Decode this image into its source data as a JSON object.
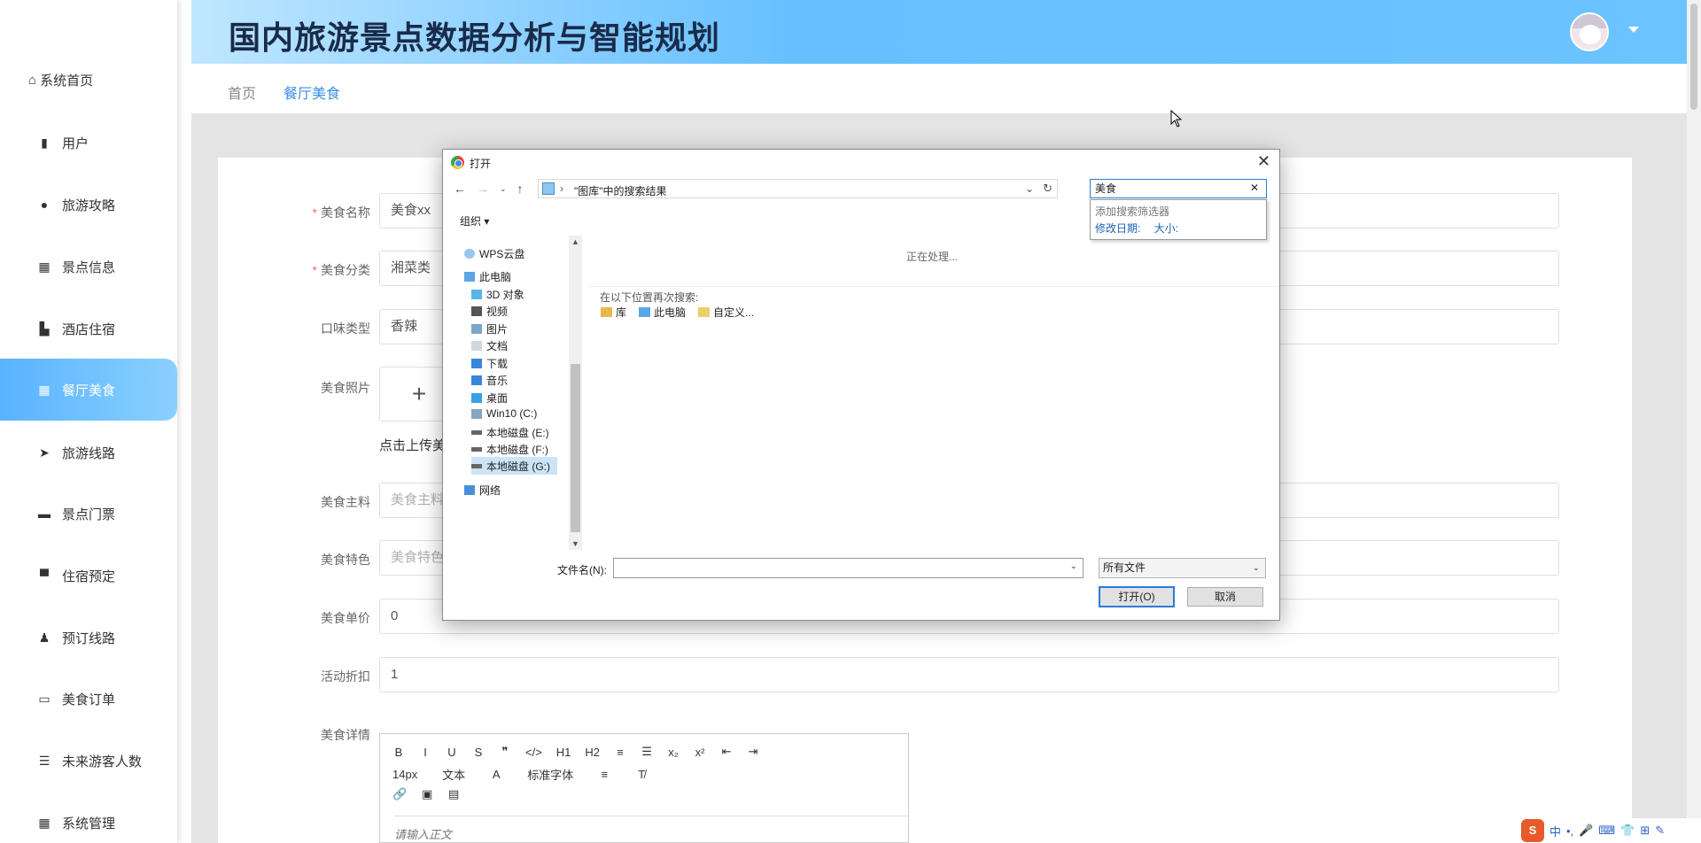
{
  "sidebar": {
    "home": "系统首页",
    "items": [
      {
        "label": "用户",
        "icon": "bar-chart-icon"
      },
      {
        "label": "旅游攻略",
        "icon": "user-icon"
      },
      {
        "label": "景点信息",
        "icon": "grid-icon"
      },
      {
        "label": "酒店住宿",
        "icon": "building-icon"
      },
      {
        "label": "餐厅美食",
        "icon": "grid-icon",
        "active": true
      },
      {
        "label": "旅游线路",
        "icon": "send-icon"
      },
      {
        "label": "景点门票",
        "icon": "ticket-icon"
      },
      {
        "label": "住宿预定",
        "icon": "bed-icon"
      },
      {
        "label": "预订线路",
        "icon": "person-icon"
      },
      {
        "label": "美食订单",
        "icon": "monitor-icon"
      },
      {
        "label": "未来游客人数",
        "icon": "list-icon"
      },
      {
        "label": "系统管理",
        "icon": "grid-icon"
      }
    ]
  },
  "header": {
    "title": "国内旅游景点数据分析与智能规划"
  },
  "breadcrumb": [
    "首页",
    "餐厅美食"
  ],
  "form": {
    "name_label": "美食名称",
    "name_value": "美食xx",
    "category_label": "美食分类",
    "category_value": "湘菜类",
    "taste_label": "口味类型",
    "taste_value": "香辣",
    "photo_label": "美食照片",
    "upload_plus": "+",
    "upload_tip": "点击上传美",
    "ingredients_label": "美食主料",
    "ingredients_placeholder": "美食主料",
    "feature_label": "美食特色",
    "feature_placeholder": "美食特色",
    "price_label": "美食单价",
    "price_value": "0",
    "discount_label": "活动折扣",
    "discount_value": "1",
    "detail_label": "美食详情",
    "required_mark": "*"
  },
  "editor": {
    "row1": [
      "B",
      "I",
      "U",
      "S",
      "❞",
      "</>",
      "H1",
      "H2",
      "≡",
      "☰",
      "x₂",
      "x²",
      "⇤",
      "⇥"
    ],
    "font_size": "14px",
    "text_type": "文本",
    "font_family": "标准字体",
    "placeholder": "请输入正文"
  },
  "dialog": {
    "title": "打开",
    "address_sep": "›",
    "address_path": "\"图库\"中的搜索结果",
    "search_value": "美食",
    "filter_header": "添加搜索筛选器",
    "filter_date": "修改日期:",
    "filter_size": "大小:",
    "organize": "组织 ▾",
    "tree": [
      {
        "label": "WPS云盘",
        "icon": "cloud-icon"
      },
      {
        "label": "此电脑",
        "icon": "computer-icon"
      },
      {
        "label": "3D 对象",
        "icon": "cube-icon"
      },
      {
        "label": "视频",
        "icon": "video-icon"
      },
      {
        "label": "图片",
        "icon": "picture-icon"
      },
      {
        "label": "文档",
        "icon": "document-icon"
      },
      {
        "label": "下载",
        "icon": "download-icon"
      },
      {
        "label": "音乐",
        "icon": "music-icon"
      },
      {
        "label": "桌面",
        "icon": "desktop-icon"
      },
      {
        "label": "Win10 (C:)",
        "icon": "drive-icon"
      },
      {
        "label": "本地磁盘 (E:)",
        "icon": "drive-icon"
      },
      {
        "label": "本地磁盘 (F:)",
        "icon": "drive-icon"
      },
      {
        "label": "本地磁盘 (G:)",
        "icon": "drive-icon",
        "selected": true
      },
      {
        "label": "网络",
        "icon": "network-icon"
      }
    ],
    "processing": "正在处理...",
    "search_again": "在以下位置再次搜索:",
    "locations": [
      "库",
      "此电脑",
      "自定义..."
    ],
    "filename_label": "文件名(N):",
    "filename_value": "",
    "filetype": "所有文件",
    "open_button": "打开(O)",
    "cancel_button": "取消"
  },
  "ime": {
    "logo": "S",
    "items": [
      "中",
      "•,",
      "🎤",
      "⌨",
      "👕",
      "⊞",
      "✎"
    ]
  }
}
